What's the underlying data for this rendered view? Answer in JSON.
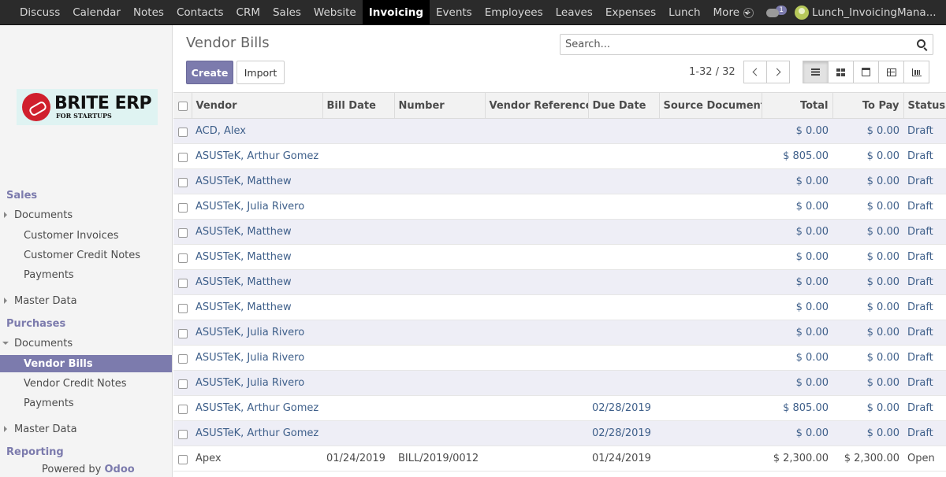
{
  "topbar": {
    "menu": [
      {
        "label": "Discuss",
        "active": false
      },
      {
        "label": "Calendar",
        "active": false
      },
      {
        "label": "Notes",
        "active": false
      },
      {
        "label": "Contacts",
        "active": false
      },
      {
        "label": "CRM",
        "active": false
      },
      {
        "label": "Sales",
        "active": false
      },
      {
        "label": "Website",
        "active": false
      },
      {
        "label": "Invoicing",
        "active": true
      },
      {
        "label": "Events",
        "active": false
      },
      {
        "label": "Employees",
        "active": false
      },
      {
        "label": "Leaves",
        "active": false
      },
      {
        "label": "Expenses",
        "active": false
      },
      {
        "label": "Lunch",
        "active": false
      }
    ],
    "more_label": "More",
    "chat_badge": "1",
    "user_name": "Lunch_InvoicingMana..."
  },
  "sidebar": {
    "logo": {
      "main": "BRITE ERP",
      "sub": "FOR STARTUPS"
    },
    "sales_section": "Sales",
    "sales_documents": "Documents",
    "sales_items": [
      "Customer Invoices",
      "Customer Credit Notes",
      "Payments"
    ],
    "sales_master_data": "Master Data",
    "purchases_section": "Purchases",
    "purchases_documents": "Documents",
    "purchases_items": [
      "Vendor Bills",
      "Vendor Credit Notes",
      "Payments"
    ],
    "purchases_master_data": "Master Data",
    "reporting_section": "Reporting",
    "powered_by": "Powered by",
    "powered_brand": "Odoo"
  },
  "control_panel": {
    "title": "Vendor Bills",
    "search_placeholder": "Search...",
    "create_label": "Create",
    "import_label": "Import",
    "pager": "1-32 / 32",
    "active_view": "list"
  },
  "table": {
    "columns": [
      "Vendor",
      "Bill Date",
      "Number",
      "Vendor Reference",
      "Due Date",
      "Source Document",
      "Total",
      "To Pay",
      "Status"
    ],
    "rows": [
      {
        "vendor": "ACD, Alex",
        "bill_date": "",
        "number": "",
        "vendor_ref": "",
        "due_date": "",
        "source": "",
        "total": "$ 0.00",
        "to_pay": "$ 0.00",
        "status": "Draft"
      },
      {
        "vendor": "ASUSTeK, Arthur Gomez",
        "bill_date": "",
        "number": "",
        "vendor_ref": "",
        "due_date": "",
        "source": "",
        "total": "$ 805.00",
        "to_pay": "$ 0.00",
        "status": "Draft"
      },
      {
        "vendor": "ASUSTeK, Matthew",
        "bill_date": "",
        "number": "",
        "vendor_ref": "",
        "due_date": "",
        "source": "",
        "total": "$ 0.00",
        "to_pay": "$ 0.00",
        "status": "Draft"
      },
      {
        "vendor": "ASUSTeK, Julia Rivero",
        "bill_date": "",
        "number": "",
        "vendor_ref": "",
        "due_date": "",
        "source": "",
        "total": "$ 0.00",
        "to_pay": "$ 0.00",
        "status": "Draft"
      },
      {
        "vendor": "ASUSTeK, Matthew",
        "bill_date": "",
        "number": "",
        "vendor_ref": "",
        "due_date": "",
        "source": "",
        "total": "$ 0.00",
        "to_pay": "$ 0.00",
        "status": "Draft"
      },
      {
        "vendor": "ASUSTeK, Matthew",
        "bill_date": "",
        "number": "",
        "vendor_ref": "",
        "due_date": "",
        "source": "",
        "total": "$ 0.00",
        "to_pay": "$ 0.00",
        "status": "Draft"
      },
      {
        "vendor": "ASUSTeK, Matthew",
        "bill_date": "",
        "number": "",
        "vendor_ref": "",
        "due_date": "",
        "source": "",
        "total": "$ 0.00",
        "to_pay": "$ 0.00",
        "status": "Draft"
      },
      {
        "vendor": "ASUSTeK, Matthew",
        "bill_date": "",
        "number": "",
        "vendor_ref": "",
        "due_date": "",
        "source": "",
        "total": "$ 0.00",
        "to_pay": "$ 0.00",
        "status": "Draft"
      },
      {
        "vendor": "ASUSTeK, Julia Rivero",
        "bill_date": "",
        "number": "",
        "vendor_ref": "",
        "due_date": "",
        "source": "",
        "total": "$ 0.00",
        "to_pay": "$ 0.00",
        "status": "Draft"
      },
      {
        "vendor": "ASUSTeK, Julia Rivero",
        "bill_date": "",
        "number": "",
        "vendor_ref": "",
        "due_date": "",
        "source": "",
        "total": "$ 0.00",
        "to_pay": "$ 0.00",
        "status": "Draft"
      },
      {
        "vendor": "ASUSTeK, Julia Rivero",
        "bill_date": "",
        "number": "",
        "vendor_ref": "",
        "due_date": "",
        "source": "",
        "total": "$ 0.00",
        "to_pay": "$ 0.00",
        "status": "Draft"
      },
      {
        "vendor": "ASUSTeK, Arthur Gomez",
        "bill_date": "",
        "number": "",
        "vendor_ref": "",
        "due_date": "02/28/2019",
        "source": "",
        "total": "$ 805.00",
        "to_pay": "$ 0.00",
        "status": "Draft"
      },
      {
        "vendor": "ASUSTeK, Arthur Gomez",
        "bill_date": "",
        "number": "",
        "vendor_ref": "",
        "due_date": "02/28/2019",
        "source": "",
        "total": "$ 0.00",
        "to_pay": "$ 0.00",
        "status": "Draft"
      },
      {
        "vendor": "Apex",
        "bill_date": "01/24/2019",
        "number": "BILL/2019/0012",
        "vendor_ref": "",
        "due_date": "01/24/2019",
        "source": "",
        "total": "$ 2,300.00",
        "to_pay": "$ 2,300.00",
        "status": "Open"
      }
    ]
  },
  "colors": {
    "accent": "#7c7bad",
    "navbar": "#2b2b2b",
    "draft_text": "#3e5f8a",
    "row_stripe": "#eeeef6"
  }
}
